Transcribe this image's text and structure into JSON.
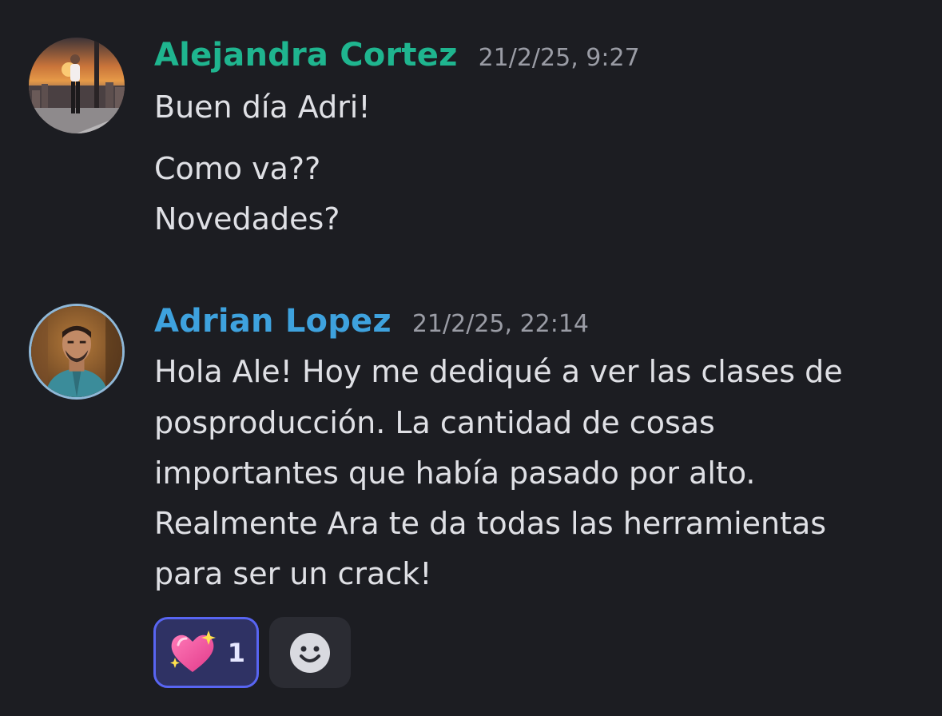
{
  "messages": [
    {
      "author": "Alejandra Cortez",
      "author_color": "#1fb58f",
      "timestamp": "21/2/25, 9:27",
      "lines": [
        "Buen día Adri!",
        "Como va??",
        "Novedades?"
      ]
    },
    {
      "author": "Adrian Lopez",
      "author_color": "#3ea2de",
      "timestamp": "21/2/25, 22:14",
      "lines": [
        "Hola Ale! Hoy me dediqué a ver las clases de",
        "posproducción. La cantidad de cosas",
        "importantes que había pasado por alto.",
        "Realmente Ara te da todas las herramientas",
        "para ser un crack!"
      ],
      "reactions": [
        {
          "icon": "sparkling-heart-icon",
          "count": "1",
          "active": true
        }
      ]
    }
  ],
  "add_reaction_icon": "smiley-face-icon",
  "colors": {
    "background": "#1c1d22",
    "text": "#dfe0e5",
    "timestamp": "#9a9ca5",
    "reaction_active_bg": "#2f3264",
    "reaction_active_border": "#5865f2"
  }
}
